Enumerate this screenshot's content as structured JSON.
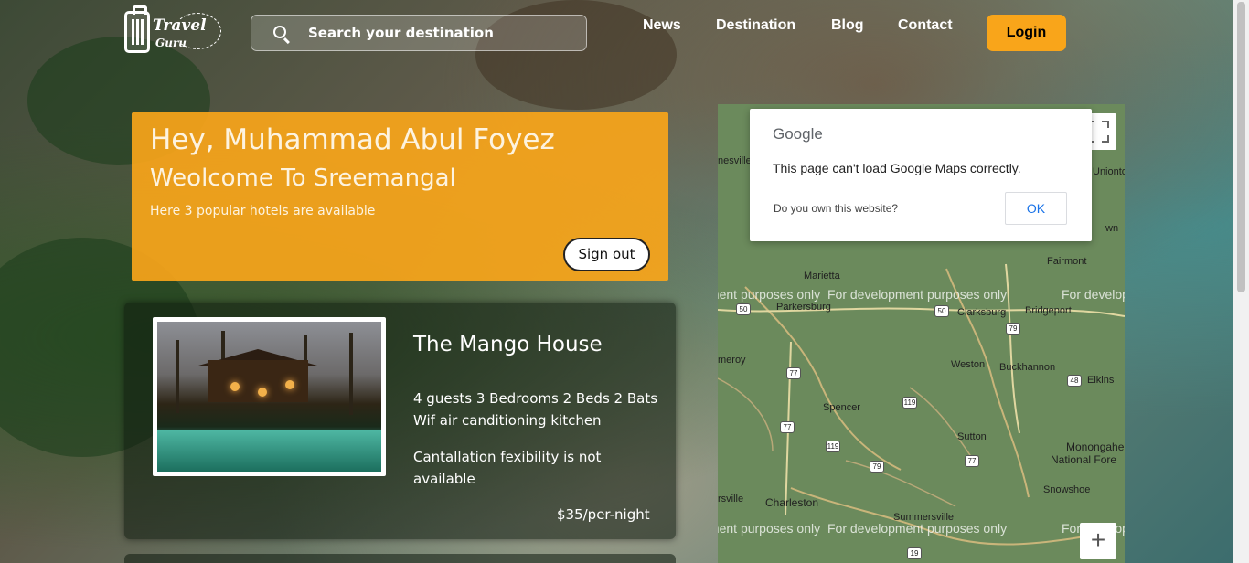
{
  "header": {
    "logo": {
      "line1": "Travel",
      "line2": "Guru"
    },
    "search": {
      "placeholder": "Search your destination"
    },
    "nav": [
      "News",
      "Destination",
      "Blog",
      "Contact"
    ],
    "login_label": "Login"
  },
  "welcome": {
    "greeting": "Hey, Muhammad Abul Foyez",
    "subtitle": "Weolcome To Sreemangal",
    "info": "Here 3 popular hotels are available",
    "signout_label": "Sign out"
  },
  "hotels": [
    {
      "name": "The Mango House",
      "features": "4 guests  3 Bedrooms  2 Beds  2 Bats",
      "amenities": "Wif air canditioning kitchen",
      "cancellation_line1": "Cantallation fexibility is not",
      "cancellation_line2": "available",
      "price": "$35/per-night"
    }
  ],
  "map": {
    "dialog": {
      "brand": "Google",
      "message": "This page can't load Google Maps correctly.",
      "own_question": "Do you own this website?",
      "ok_label": "OK"
    },
    "dev_notice": "For development purposes only",
    "places": [
      "nesville",
      "Uniontow",
      "wn",
      "Fairmont",
      "Marietta",
      "Parkersburg",
      "Clarksburg",
      "Bridgeport",
      "meroy",
      "Weston",
      "Buckhannon",
      "Elkins",
      "Spencer",
      "Sutton",
      "Monongahela",
      "National Fore",
      "Snowshoe",
      "rsville",
      "Charleston",
      "Summersville"
    ],
    "highway_shields": [
      "50",
      "50",
      "79",
      "77",
      "119",
      "48",
      "77",
      "119",
      "79",
      "77",
      "19"
    ],
    "zoom_in_label": "+"
  },
  "colors": {
    "accent": "#f9a51a",
    "map_land": "#6b8a5c",
    "link_blue": "#1a73e8"
  }
}
